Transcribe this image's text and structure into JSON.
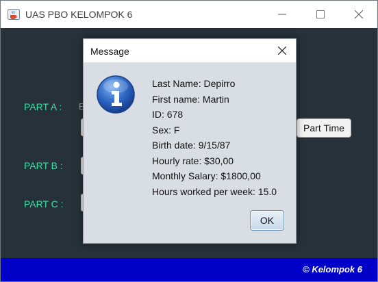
{
  "window": {
    "title": "UAS PBO KELOMPOK 6",
    "icon": "java-cup-icon",
    "controls": [
      "minimize-icon",
      "maximize-icon",
      "close-icon"
    ]
  },
  "main": {
    "part_a_label": "PART A :",
    "part_a_text_stub": "E",
    "part_b_label": "PART B :",
    "part_c_label": "PART C :",
    "part_time_button": "Part Time"
  },
  "footer": {
    "text": "© Kelompok 6",
    "color": "#0000c8"
  },
  "dialog": {
    "title": "Message",
    "icon": "info-icon",
    "lines": [
      "Last Name: Depirro",
      "First name: Martin",
      "ID: 678",
      "Sex: F",
      "Birth date: 9/15/87",
      "Hourly rate: $30,00",
      "Monthly Salary: $1800,00",
      "Hours worked per week: 15.0"
    ],
    "ok_label": "OK"
  },
  "colors": {
    "background": "#263139",
    "label": "#3fe0a8",
    "dialog_bg": "#d9dde4"
  }
}
